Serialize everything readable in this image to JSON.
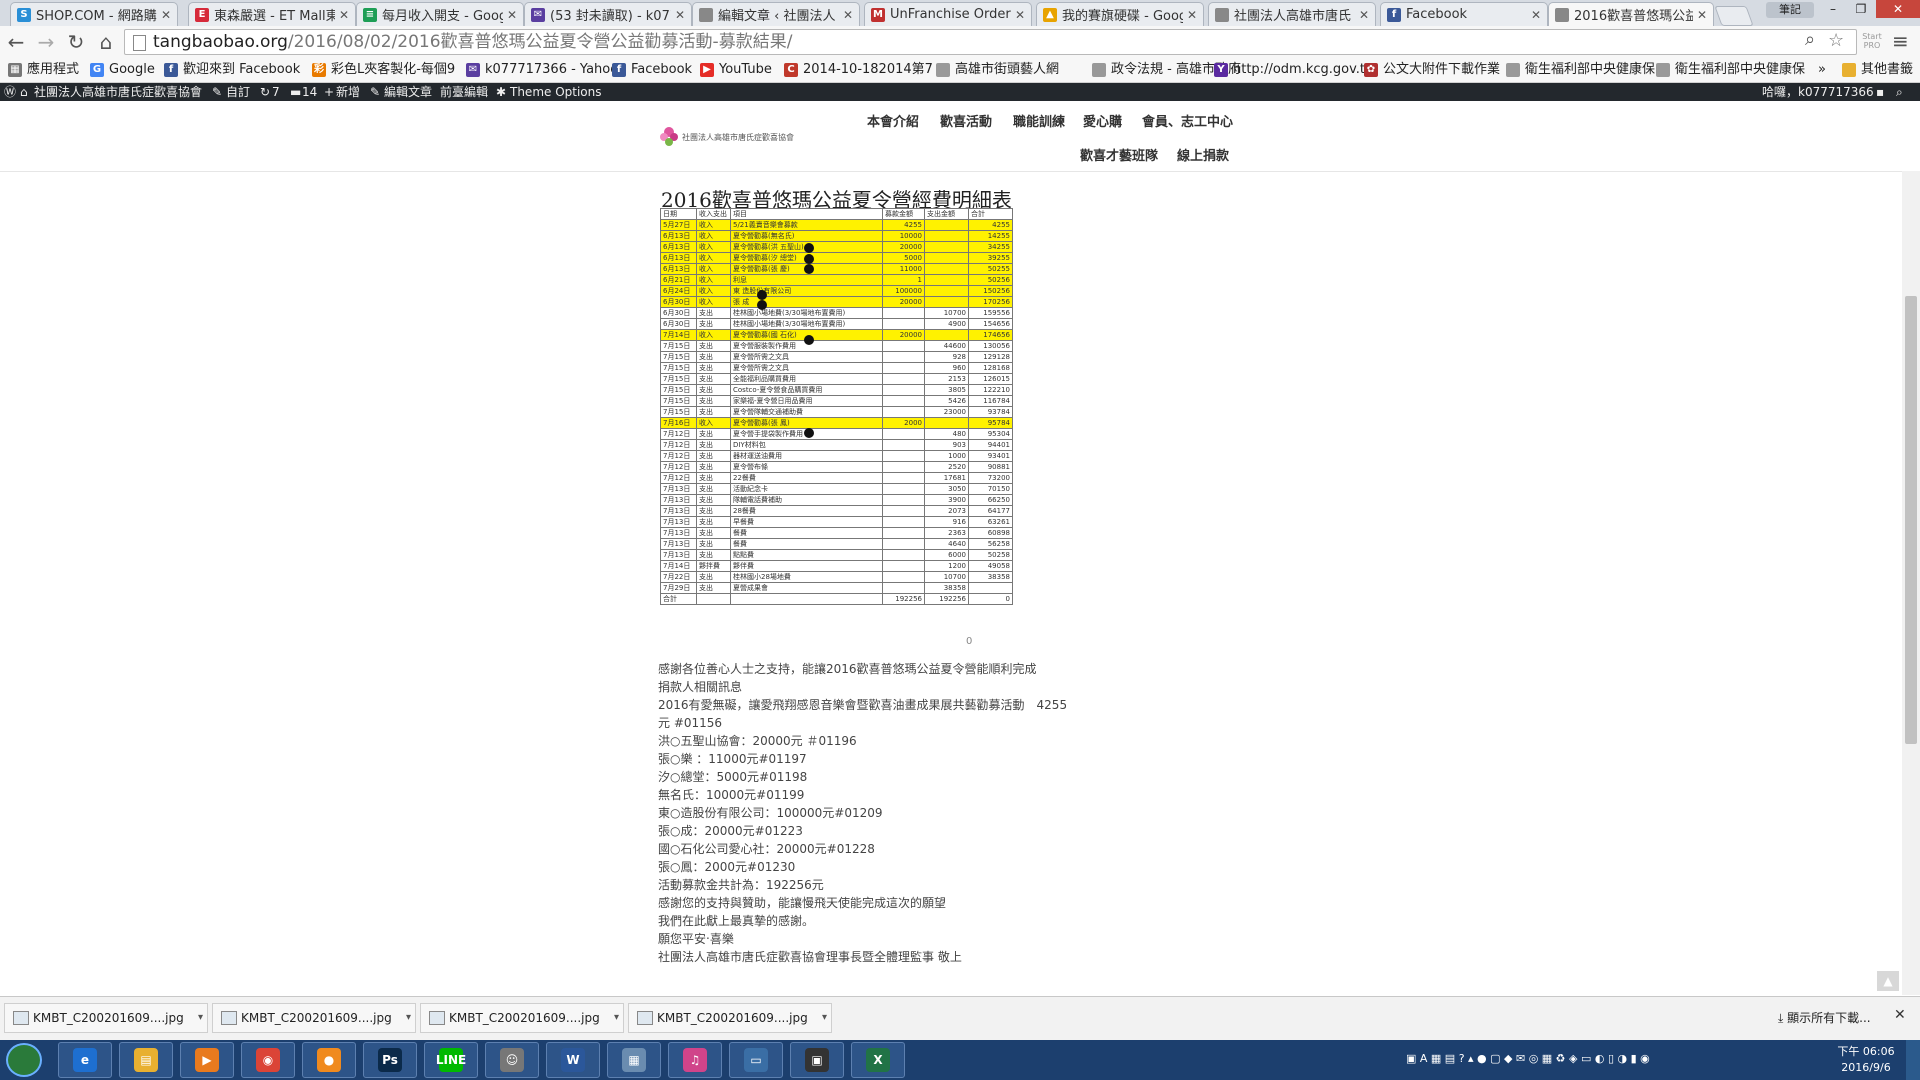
{
  "browser": {
    "tabs": [
      {
        "title": "SHOP.COM - 網路購",
        "color": "#2a8fd6",
        "glyph": "S"
      },
      {
        "title": "東森嚴選 - ET Mall東",
        "color": "#d62a3a",
        "glyph": "E"
      },
      {
        "title": "每月收入開支 - Goog",
        "color": "#1e9e56",
        "glyph": "≡"
      },
      {
        "title": "(53 封未讀取) - k077",
        "color": "#5a3ea0",
        "glyph": "✉"
      },
      {
        "title": "編輯文章 ‹ 社團法人",
        "color": "#888888",
        "glyph": ""
      },
      {
        "title": "UnFranchise Order",
        "color": "#c03030",
        "glyph": "M"
      },
      {
        "title": "我的賽旗硬碟 - Goog",
        "color": "#e8a300",
        "glyph": "▲"
      },
      {
        "title": "社團法人高雄市唐氏",
        "color": "#888888",
        "glyph": ""
      },
      {
        "title": "Facebook",
        "color": "#3b5998",
        "glyph": "f"
      },
      {
        "title": "2016歡喜普悠瑪公益",
        "color": "#888888",
        "glyph": ""
      }
    ],
    "close_glyph": "✕",
    "profile_name": "筆記",
    "url_host": "tangbaobao.org",
    "url_path": "/2016/08/02/2016歡喜普悠瑪公益夏令營公益勸募活動-募款結果/",
    "ext_label": "Start PRO",
    "bookmarks": [
      {
        "label": "應用程式",
        "color": "#777777",
        "glyph": "▦"
      },
      {
        "label": "Google",
        "color": "#4285f4",
        "glyph": "G"
      },
      {
        "label": "歡迎來到 Facebook",
        "color": "#3b5998",
        "glyph": "f"
      },
      {
        "label": "彩色L夾客製化-每個9",
        "color": "#e87a00",
        "glyph": "彩"
      },
      {
        "label": "k077717366 - Yahoo",
        "color": "#5a3ea0",
        "glyph": "✉"
      },
      {
        "label": "Facebook",
        "color": "#3b5998",
        "glyph": "f"
      },
      {
        "label": "YouTube",
        "color": "#e52d27",
        "glyph": "▶"
      },
      {
        "label": "2014-10-182014第7",
        "color": "#c0392b",
        "glyph": "C"
      },
      {
        "label": "高雄市街頭藝人網",
        "color": "#999999",
        "glyph": ""
      },
      {
        "label": "政令法規 - 高雄市政府",
        "color": "#999999",
        "glyph": ""
      },
      {
        "label": "http://odm.kcg.gov.t",
        "color": "#5a2aa0",
        "glyph": "Y"
      },
      {
        "label": "公文大附件下載作業",
        "color": "#b03030",
        "glyph": "✿"
      },
      {
        "label": "衛生福利部中央健康保",
        "color": "#999999",
        "glyph": ""
      },
      {
        "label": "衛生福利部中央健康保",
        "color": "#999999",
        "glyph": ""
      }
    ],
    "bookmarks_more": "»",
    "other_bookmarks": "其他書籤"
  },
  "wp_admin_bar": {
    "site_name": "社團法人高雄市唐氏症歡喜協會",
    "customize": "自訂",
    "updates": "7",
    "comments": "14",
    "new": "新增",
    "edit_post": "編輯文章",
    "frontend_edit": "前臺編輯",
    "theme_options": "Theme Options",
    "greeting": "哈囉，k077717366"
  },
  "site": {
    "logo_text": "社團法人高雄市唐氏症歡喜協會",
    "nav_row1": [
      "本會介紹",
      "歡喜活動",
      "職能訓練",
      "愛心購",
      "會員、志工中心"
    ],
    "nav_row2": [
      "歡喜才藝班隊",
      "線上捐款"
    ]
  },
  "document": {
    "title": "2016歡喜普悠瑪公益夏令營經費明細表",
    "header": [
      "日期",
      "收入支出",
      "項目",
      "募款金額",
      "支出金額",
      "合計"
    ],
    "rows": [
      {
        "d": "5月27日",
        "t": "收入",
        "item": "5/21義賣音樂會募款",
        "in": "4255",
        "out": "",
        "total": "4255",
        "hl": true
      },
      {
        "d": "6月13日",
        "t": "收入",
        "item": "夏令營勸募(無名氏)",
        "in": "10000",
        "out": "",
        "total": "14255",
        "hl": true
      },
      {
        "d": "6月13日",
        "t": "收入",
        "item": "夏令營勸募(洪 五聖山)",
        "in": "20000",
        "out": "",
        "total": "34255",
        "hl": true
      },
      {
        "d": "6月13日",
        "t": "收入",
        "item": "夏令營勸募(汐 總堂)",
        "in": "5000",
        "out": "",
        "total": "39255",
        "hl": true
      },
      {
        "d": "6月13日",
        "t": "收入",
        "item": "夏令營勸募(張 慶)",
        "in": "11000",
        "out": "",
        "total": "50255",
        "hl": true
      },
      {
        "d": "6月21日",
        "t": "收入",
        "item": "利息",
        "in": "1",
        "out": "",
        "total": "50256",
        "hl": true
      },
      {
        "d": "6月24日",
        "t": "收入",
        "item": "東 造股份有限公司",
        "in": "100000",
        "out": "",
        "total": "150256",
        "hl": true
      },
      {
        "d": "6月30日",
        "t": "收入",
        "item": "張 成",
        "in": "20000",
        "out": "",
        "total": "170256",
        "hl": true
      },
      {
        "d": "6月30日",
        "t": "支出",
        "item": "桂林國小場地費(3/30場地布置費用)",
        "in": "",
        "out": "10700",
        "total": "159556",
        "hl": false
      },
      {
        "d": "6月30日",
        "t": "支出",
        "item": "桂林國小場地費(3/30場地布置費用)",
        "in": "",
        "out": "4900",
        "total": "154656",
        "hl": false
      },
      {
        "d": "7月14日",
        "t": "收入",
        "item": "夏令營勸募(國 石化)",
        "in": "20000",
        "out": "",
        "total": "174656",
        "hl": true
      },
      {
        "d": "7月15日",
        "t": "支出",
        "item": "夏令營服裝製作費用",
        "in": "",
        "out": "44600",
        "total": "130056",
        "hl": false
      },
      {
        "d": "7月15日",
        "t": "支出",
        "item": "夏令營所需之文具",
        "in": "",
        "out": "928",
        "total": "129128",
        "hl": false
      },
      {
        "d": "7月15日",
        "t": "支出",
        "item": "夏令營所需之文具",
        "in": "",
        "out": "960",
        "total": "128168",
        "hl": false
      },
      {
        "d": "7月15日",
        "t": "支出",
        "item": "全能福利品購買費用",
        "in": "",
        "out": "2153",
        "total": "126015",
        "hl": false
      },
      {
        "d": "7月15日",
        "t": "支出",
        "item": "Costco-夏令營食品購買費用",
        "in": "",
        "out": "3805",
        "total": "122210",
        "hl": false
      },
      {
        "d": "7月15日",
        "t": "支出",
        "item": "家樂福-夏令營日用品費用",
        "in": "",
        "out": "5426",
        "total": "116784",
        "hl": false
      },
      {
        "d": "7月15日",
        "t": "支出",
        "item": "夏令營隊輔交通補助費",
        "in": "",
        "out": "23000",
        "total": "93784",
        "hl": false
      },
      {
        "d": "7月16日",
        "t": "收入",
        "item": "夏令營勸募(張 鳳)",
        "in": "2000",
        "out": "",
        "total": "95784",
        "hl": true
      },
      {
        "d": "7月12日",
        "t": "支出",
        "item": "夏令營手提袋製作費用",
        "in": "",
        "out": "480",
        "total": "95304",
        "hl": false
      },
      {
        "d": "7月12日",
        "t": "支出",
        "item": "DIY材料包",
        "in": "",
        "out": "903",
        "total": "94401",
        "hl": false
      },
      {
        "d": "7月12日",
        "t": "支出",
        "item": "器材運送油費用",
        "in": "",
        "out": "1000",
        "total": "93401",
        "hl": false
      },
      {
        "d": "7月12日",
        "t": "支出",
        "item": "夏令營布條",
        "in": "",
        "out": "2520",
        "total": "90881",
        "hl": false
      },
      {
        "d": "7月12日",
        "t": "支出",
        "item": "22餐費",
        "in": "",
        "out": "17681",
        "total": "73200",
        "hl": false
      },
      {
        "d": "7月13日",
        "t": "支出",
        "item": "活動紀念卡",
        "in": "",
        "out": "3050",
        "total": "70150",
        "hl": false
      },
      {
        "d": "7月13日",
        "t": "支出",
        "item": "隊輔電話費補助",
        "in": "",
        "out": "3900",
        "total": "66250",
        "hl": false
      },
      {
        "d": "7月13日",
        "t": "支出",
        "item": "28餐費",
        "in": "",
        "out": "2073",
        "total": "64177",
        "hl": false
      },
      {
        "d": "7月13日",
        "t": "支出",
        "item": "早餐費",
        "in": "",
        "out": "916",
        "total": "63261",
        "hl": false
      },
      {
        "d": "7月13日",
        "t": "支出",
        "item": "餐費",
        "in": "",
        "out": "2363",
        "total": "60898",
        "hl": false
      },
      {
        "d": "7月13日",
        "t": "支出",
        "item": "餐費",
        "in": "",
        "out": "4640",
        "total": "56258",
        "hl": false
      },
      {
        "d": "7月13日",
        "t": "支出",
        "item": "點點費",
        "in": "",
        "out": "6000",
        "total": "50258",
        "hl": false
      },
      {
        "d": "7月14日",
        "t": "夥拌費",
        "item": "夥伴費",
        "in": "",
        "out": "1200",
        "total": "49058",
        "hl": false
      },
      {
        "d": "7月22日",
        "t": "支出",
        "item": "桂林國小28場地費",
        "in": "",
        "out": "10700",
        "total": "38358",
        "hl": false
      },
      {
        "d": "7月29日",
        "t": "支出",
        "item": "夏營成果會",
        "in": "",
        "out": "38358",
        "total": "",
        "hl": false
      },
      {
        "d": "合計",
        "t": "",
        "item": "",
        "in": "192256",
        "out": "192256",
        "total": "0",
        "hl": false
      }
    ],
    "below_zero": "0"
  },
  "article": [
    "感謝各位善心人士之支持，能讓2016歡喜普悠瑪公益夏令營能順利完成",
    "捐款人相關訊息",
    "2016有愛無礙，讓愛飛翔感恩音樂會暨歡喜油畫成果展共藝勸募活動　4255元 #01156",
    "洪○五聖山協會：20000元 ＃01196",
    "張○樂 ：11000元#01197",
    "汐○總堂：5000元#01198",
    "無名氏：10000元#01199",
    "東○造股份有限公司：100000元#01209",
    "張○成：20000元#01223",
    "國○石化公司愛心社：20000元#01228",
    "張○鳳：2000元#01230",
    "活動募款金共計為：192256元",
    "感謝您的支持與贊助，能讓慢飛天使能完成這次的願望",
    "我們在此獻上最真摯的感謝。",
    "願您平安‧喜樂",
    "社團法人高雄市唐氏症歡喜協會理事長暨全體理監事 敬上"
  ],
  "downloads": {
    "items": [
      "KMBT_C200201609....jpg",
      "KMBT_C200201609....jpg",
      "KMBT_C200201609....jpg",
      "KMBT_C200201609....jpg"
    ],
    "show_all": "顯示所有下載...",
    "close": "✕"
  },
  "taskbar": {
    "apps": [
      {
        "name": "ie",
        "color": "#1e6fd0",
        "glyph": "e"
      },
      {
        "name": "explorer",
        "color": "#e8b030",
        "glyph": "▤"
      },
      {
        "name": "media-player",
        "color": "#e87a1e",
        "glyph": "▶"
      },
      {
        "name": "chrome",
        "color": "#db4437",
        "glyph": "◉"
      },
      {
        "name": "orange-app",
        "color": "#f08a1e",
        "glyph": "●"
      },
      {
        "name": "photoshop",
        "color": "#0b2a4a",
        "glyph": "Ps"
      },
      {
        "name": "line",
        "color": "#00b900",
        "glyph": "LINE"
      },
      {
        "name": "network",
        "color": "#777777",
        "glyph": "☺"
      },
      {
        "name": "word",
        "color": "#2b579a",
        "glyph": "W"
      },
      {
        "name": "calculator",
        "color": "#6a8cb0",
        "glyph": "▦"
      },
      {
        "name": "itunes",
        "color": "#d0448a",
        "glyph": "♫"
      },
      {
        "name": "window-app",
        "color": "#3a6ea5",
        "glyph": "▭"
      },
      {
        "name": "dvr",
        "color": "#333333",
        "glyph": "▣"
      },
      {
        "name": "excel",
        "color": "#217346",
        "glyph": "X"
      }
    ],
    "time": "下午 06:06",
    "date": "2016/9/6"
  }
}
